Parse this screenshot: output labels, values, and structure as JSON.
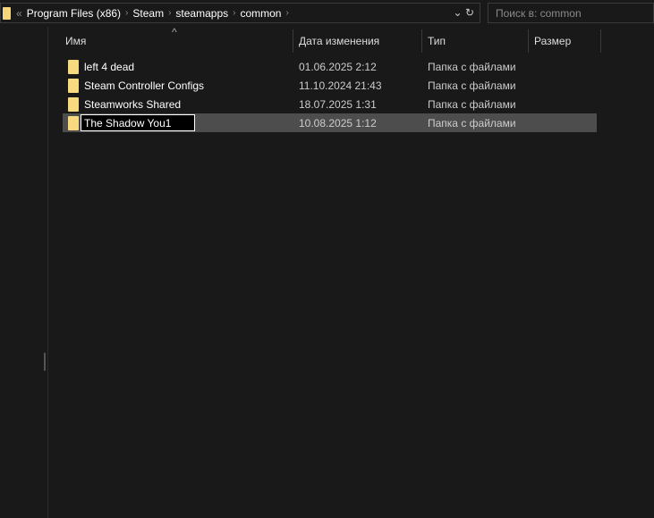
{
  "address": {
    "overflow": "«",
    "crumbs": [
      "Program Files (x86)",
      "Steam",
      "steamapps",
      "common"
    ],
    "separator": "›",
    "dropdown": "⌄",
    "refresh": "↻"
  },
  "search": {
    "placeholder": "Поиск в: common"
  },
  "columns": {
    "sort_indicator": "^",
    "name": "Имя",
    "date": "Дата изменения",
    "type": "Тип",
    "size": "Размер"
  },
  "rows": [
    {
      "name": "left 4 dead",
      "date": "01.06.2025 2:12",
      "type": "Папка с файлами"
    },
    {
      "name": "Steam Controller Configs",
      "date": "11.10.2024 21:43",
      "type": "Папка с файлами"
    },
    {
      "name": "Steamworks Shared",
      "date": "18.07.2025 1:31",
      "type": "Папка с файлами"
    },
    {
      "name": "The Shadow You1",
      "date": "10.08.2025 1:12",
      "type": "Папка с файлами"
    }
  ]
}
